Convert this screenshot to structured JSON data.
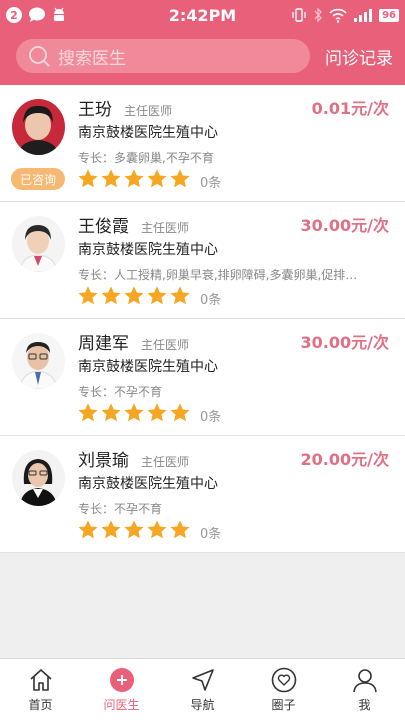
{
  "status_bar": {
    "notification_count": "2",
    "time": "2:42PM",
    "battery": "96"
  },
  "header": {
    "search_placeholder": "搜索医生",
    "consult_records": "问诊记录"
  },
  "doctors": [
    {
      "name": "王玢",
      "title": "主任医师",
      "hospital": "南京鼓楼医院生殖中心",
      "specialty": "专长：多囊卵巢,不孕不育",
      "price": "0.01元/次",
      "reviews": "0条",
      "rating": 5,
      "consulted_badge": "已咨询"
    },
    {
      "name": "王俊霞",
      "title": "主任医师",
      "hospital": "南京鼓楼医院生殖中心",
      "specialty": "专长：人工授精,卵巢早衰,排卵障碍,多囊卵巢,促排…",
      "price": "30.00元/次",
      "reviews": "0条",
      "rating": 5
    },
    {
      "name": "周建军",
      "title": "主任医师",
      "hospital": "南京鼓楼医院生殖中心",
      "specialty": "专长：不孕不育",
      "price": "30.00元/次",
      "reviews": "0条",
      "rating": 5
    },
    {
      "name": "刘景瑜",
      "title": "主任医师",
      "hospital": "南京鼓楼医院生殖中心",
      "specialty": "专长：不孕不育",
      "price": "20.00元/次",
      "reviews": "0条",
      "rating": 5
    }
  ],
  "tabs": [
    {
      "label": "首页",
      "icon": "home-icon"
    },
    {
      "label": "问医生",
      "icon": "ask-doctor-icon",
      "active": true
    },
    {
      "label": "导航",
      "icon": "navigation-icon"
    },
    {
      "label": "圈子",
      "icon": "circle-heart-icon"
    },
    {
      "label": "我",
      "icon": "user-icon"
    }
  ],
  "colors": {
    "accent": "#e8607a",
    "price": "#e07085",
    "star": "#f5a623",
    "badge": "#f6b873"
  }
}
